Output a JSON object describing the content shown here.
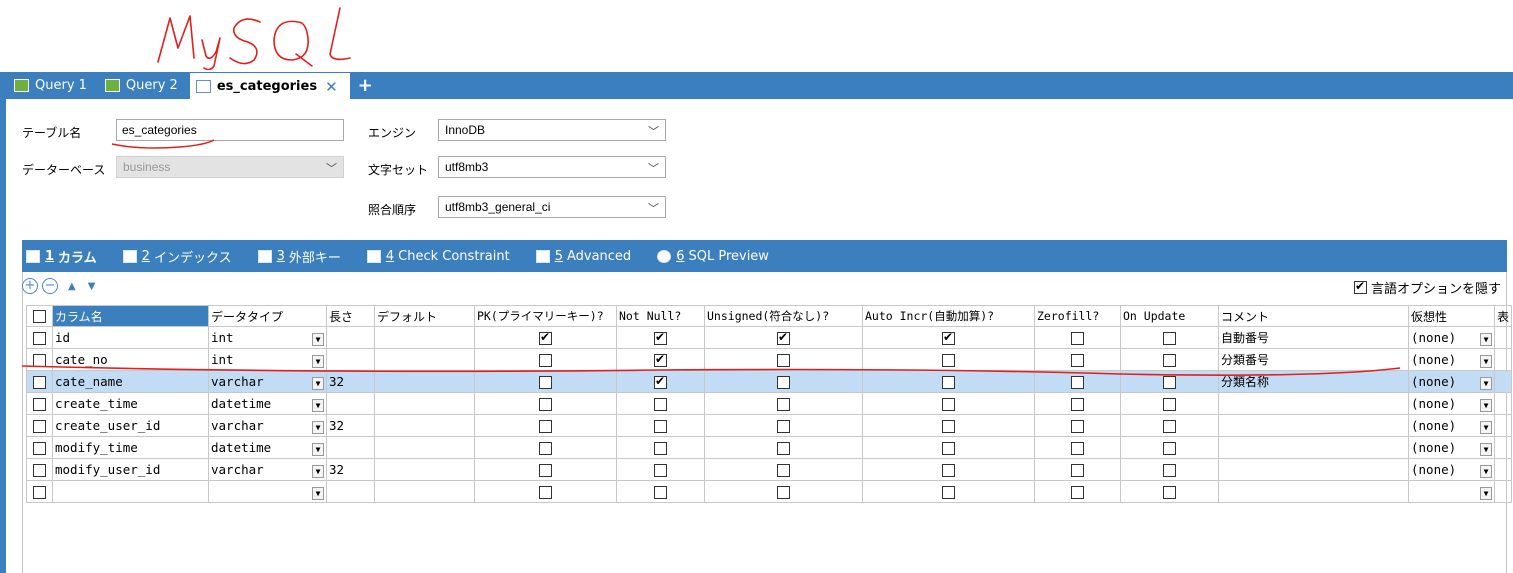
{
  "annotation": {
    "handwritten_title": "MySQL"
  },
  "tabs": [
    {
      "label": "Query 1",
      "active": false
    },
    {
      "label": "Query 2",
      "active": false
    },
    {
      "label": "es_categories",
      "active": true
    }
  ],
  "add_tab_symbol": "+",
  "form": {
    "table_name_label": "テーブル名",
    "table_name_value": "es_categories",
    "database_label": "データーベース",
    "database_value": "business",
    "engine_label": "エンジン",
    "engine_value": "InnoDB",
    "charset_label": "文字セット",
    "charset_value": "utf8mb3",
    "collation_label": "照合順序",
    "collation_value": "utf8mb3_general_ci"
  },
  "subtabs": [
    {
      "num": "1",
      "label": "カラム",
      "active": true
    },
    {
      "num": "2",
      "label": "インデックス",
      "active": false
    },
    {
      "num": "3",
      "label": "外部キー",
      "active": false
    },
    {
      "num": "4",
      "label": "Check Constraint",
      "active": false
    },
    {
      "num": "5",
      "label": "Advanced",
      "active": false
    },
    {
      "num": "6",
      "label": "SQL Preview",
      "active": false
    }
  ],
  "toolbar": {
    "add": "+",
    "remove": "−",
    "up": "▲",
    "down": "▼"
  },
  "language_option": {
    "label": "言語オプションを隠す",
    "checked": true
  },
  "grid": {
    "headers": [
      "カラム名",
      "データタイプ",
      "長さ",
      "デフォルト",
      "PK(プライマリーキー)?",
      "Not Null?",
      "Unsigned(符合なし)?",
      "Auto Incr(自動加算)?",
      "Zerofill?",
      "On Update",
      "コメント",
      "仮想性",
      "表"
    ],
    "rows": [
      {
        "name": "id",
        "type": "int",
        "length": "",
        "default": "",
        "pk": true,
        "notnull": true,
        "unsigned": true,
        "autoinc": true,
        "zerofill": false,
        "onupdate": false,
        "comment": "自動番号",
        "virtual": "(none)",
        "selected": false
      },
      {
        "name": "cate_no",
        "type": "int",
        "length": "",
        "default": "",
        "pk": false,
        "notnull": true,
        "unsigned": false,
        "autoinc": false,
        "zerofill": false,
        "onupdate": false,
        "comment": "分類番号",
        "virtual": "(none)",
        "selected": false
      },
      {
        "name": "cate_name",
        "type": "varchar",
        "length": "32",
        "default": "",
        "pk": false,
        "notnull": true,
        "unsigned": false,
        "autoinc": false,
        "zerofill": false,
        "onupdate": false,
        "comment": "分類名称",
        "virtual": "(none)",
        "selected": true
      },
      {
        "name": "create_time",
        "type": "datetime",
        "length": "",
        "default": "",
        "pk": false,
        "notnull": false,
        "unsigned": false,
        "autoinc": false,
        "zerofill": false,
        "onupdate": false,
        "comment": "",
        "virtual": "(none)",
        "selected": false
      },
      {
        "name": "create_user_id",
        "type": "varchar",
        "length": "32",
        "default": "",
        "pk": false,
        "notnull": false,
        "unsigned": false,
        "autoinc": false,
        "zerofill": false,
        "onupdate": false,
        "comment": "",
        "virtual": "(none)",
        "selected": false
      },
      {
        "name": "modify_time",
        "type": "datetime",
        "length": "",
        "default": "",
        "pk": false,
        "notnull": false,
        "unsigned": false,
        "autoinc": false,
        "zerofill": false,
        "onupdate": false,
        "comment": "",
        "virtual": "(none)",
        "selected": false
      },
      {
        "name": "modify_user_id",
        "type": "varchar",
        "length": "32",
        "default": "",
        "pk": false,
        "notnull": false,
        "unsigned": false,
        "autoinc": false,
        "zerofill": false,
        "onupdate": false,
        "comment": "",
        "virtual": "(none)",
        "selected": false
      },
      {
        "name": "",
        "type": "",
        "length": "",
        "default": "",
        "pk": false,
        "notnull": false,
        "unsigned": false,
        "autoinc": false,
        "zerofill": false,
        "onupdate": false,
        "comment": "",
        "virtual": "",
        "selected": false
      }
    ]
  },
  "colors": {
    "accent": "#3c7fbf",
    "selection": "#c3dcf5",
    "annotation": "#e0201e"
  }
}
